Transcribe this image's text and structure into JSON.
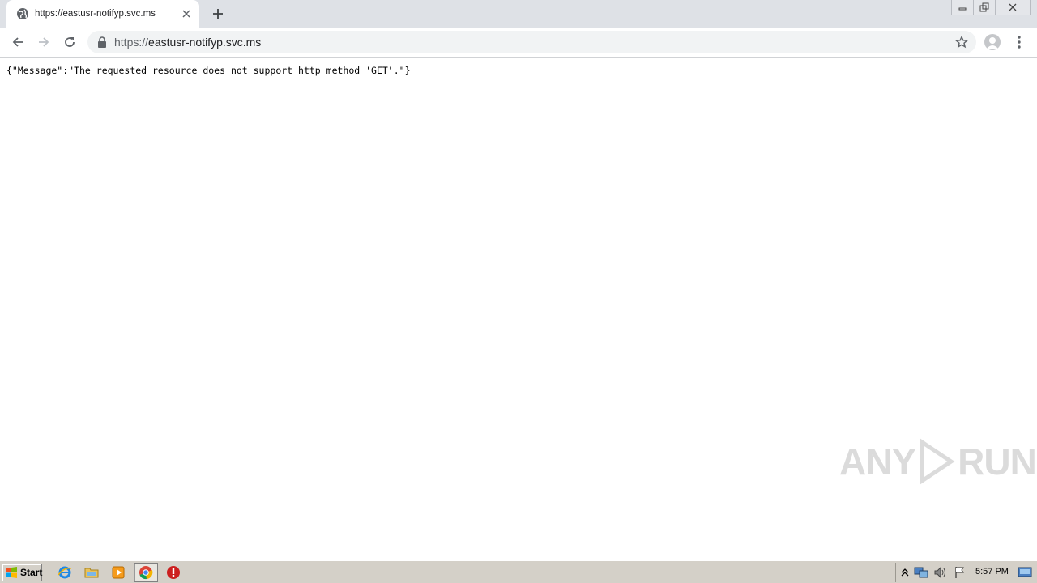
{
  "browser": {
    "tab": {
      "title": "https://eastusr-notifyp.svc.ms",
      "favicon": "globe-icon"
    },
    "omnibox": {
      "scheme": "https://",
      "host": "eastusr-notifyp.svc.ms"
    }
  },
  "page": {
    "body_text": "{\"Message\":\"The requested resource does not support http method 'GET'.\"}"
  },
  "watermark": {
    "text_left": "ANY",
    "text_right": "RUN"
  },
  "taskbar": {
    "start_label": "Start",
    "pinned": [
      "ie-icon",
      "explorer-folder-icon",
      "media-player-icon",
      "chrome-icon",
      "stop-icon"
    ],
    "clock": "5:57 PM"
  },
  "colors": {
    "tabstrip": "#dee1e6",
    "omnibox": "#f1f3f4",
    "taskbar": "#d4d0c8"
  }
}
